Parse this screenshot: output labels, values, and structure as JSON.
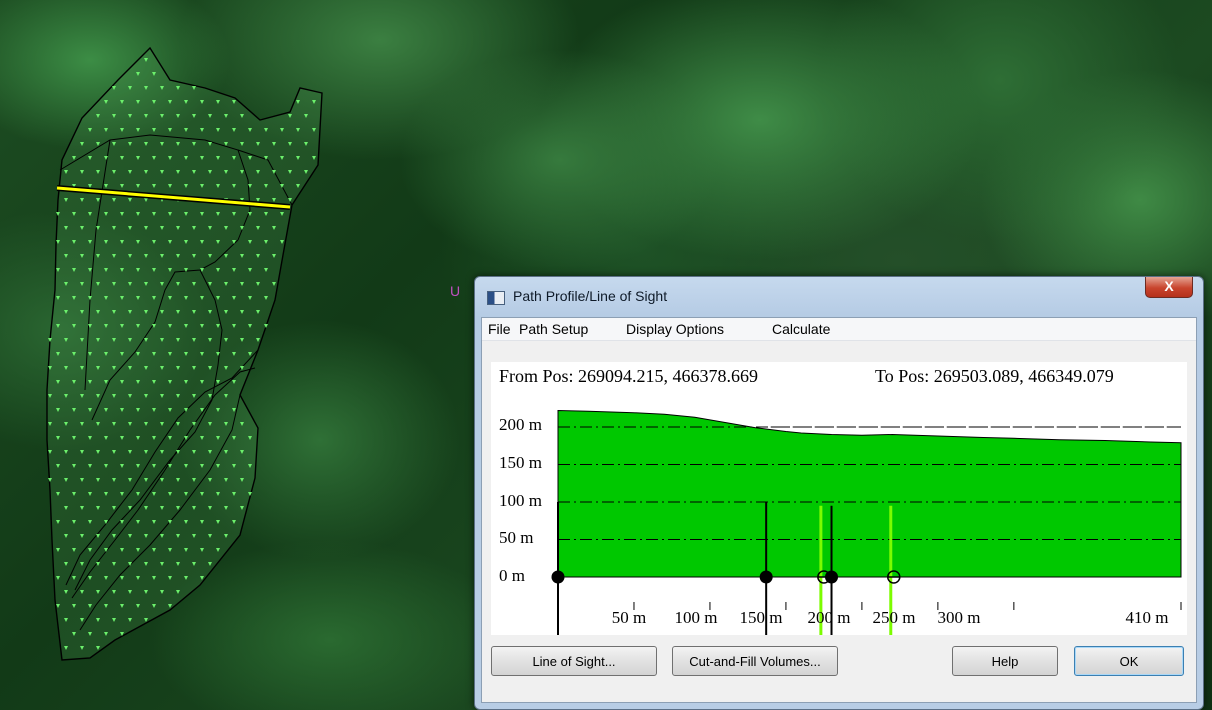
{
  "window": {
    "title": "Path Profile/Line of Sight",
    "close_glyph": "X"
  },
  "menu": {
    "items": [
      "File",
      "Path Setup",
      "Display Options",
      "Calculate"
    ]
  },
  "positions": {
    "from": "From Pos: 269094.215, 466378.669",
    "to": "To Pos: 269503.089, 466349.079"
  },
  "chart_data": {
    "type": "area",
    "x_range": [
      0,
      410
    ],
    "y_range": [
      0,
      220
    ],
    "y_ticks": [
      "200 m",
      "150 m",
      "100 m",
      "50 m",
      "0 m"
    ],
    "x_ticks": [
      "50 m",
      "100 m",
      "150 m",
      "200 m",
      "250 m",
      "300 m",
      "410 m"
    ],
    "profile": {
      "x": [
        0,
        20,
        50,
        70,
        90,
        110,
        130,
        150,
        160,
        180,
        200,
        220,
        250,
        280,
        300,
        330,
        360,
        390,
        410
      ],
      "y": [
        222,
        221,
        219,
        217,
        213,
        206,
        199,
        194,
        192,
        190,
        189,
        190,
        188,
        186,
        185,
        183,
        182,
        180,
        179
      ]
    },
    "line_of_sight_elevation": 200,
    "observer_marks": [
      {
        "x": 0,
        "elevation": 100,
        "color": "#000000",
        "style": "filled"
      },
      {
        "x": 137,
        "elevation": 100,
        "color": "#000000",
        "style": "filled"
      },
      {
        "x": 180,
        "elevation": 95,
        "color": "#000000",
        "style": "filled"
      },
      {
        "x": 173,
        "elevation": 95,
        "color": "#7CFC00",
        "style": "hollow"
      },
      {
        "x": 219,
        "elevation": 95,
        "color": "#7CFC00",
        "style": "hollow"
      }
    ],
    "colors": {
      "fill": "#00c800",
      "edge": "#000000"
    },
    "grid": true
  },
  "buttons": {
    "line_of_sight": "Line of Sight...",
    "cut_fill": "Cut-and-Fill Volumes...",
    "help": "Help",
    "ok": "OK"
  },
  "map": {
    "colors": {
      "area_outline": "#000000",
      "point_marker": "#6cf06c",
      "path_line": "#ffff00"
    },
    "cursor_glyph": "U"
  }
}
